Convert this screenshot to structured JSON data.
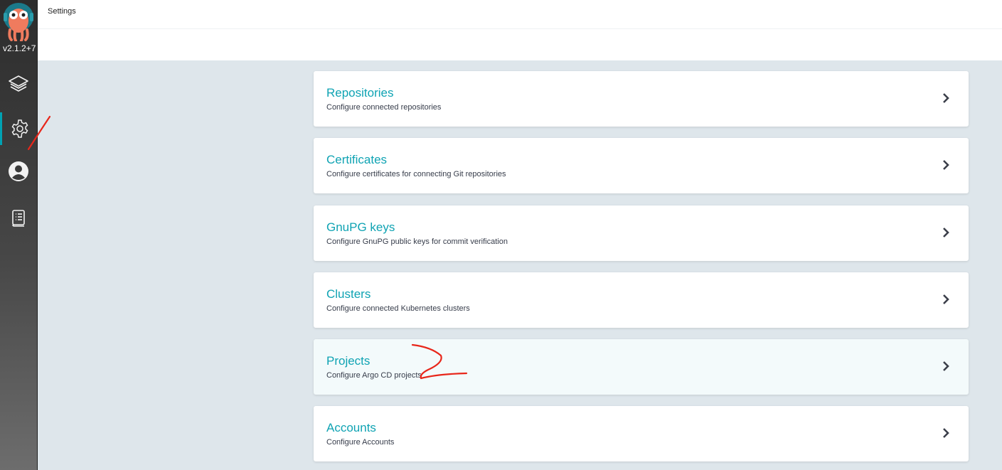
{
  "sidebar": {
    "version": "v2.1.2+7",
    "items": [
      {
        "id": "applications",
        "icon": "layers-icon"
      },
      {
        "id": "settings",
        "icon": "gear-icon",
        "active": true
      },
      {
        "id": "user-info",
        "icon": "user-circle-icon"
      },
      {
        "id": "docs",
        "icon": "book-icon"
      }
    ]
  },
  "header": {
    "title": "Settings"
  },
  "cards": [
    {
      "title": "Repositories",
      "description": "Configure connected repositories"
    },
    {
      "title": "Certificates",
      "description": "Configure certificates for connecting Git repositories"
    },
    {
      "title": "GnuPG keys",
      "description": "Configure GnuPG public keys for commit verification"
    },
    {
      "title": "Clusters",
      "description": "Configure connected Kubernetes clusters"
    },
    {
      "title": "Projects",
      "description": "Configure Argo CD projects",
      "hovered": true
    },
    {
      "title": "Accounts",
      "description": "Configure Accounts"
    }
  ],
  "colors": {
    "accent": "#0fa3b3",
    "annotation": "#e8261a"
  }
}
